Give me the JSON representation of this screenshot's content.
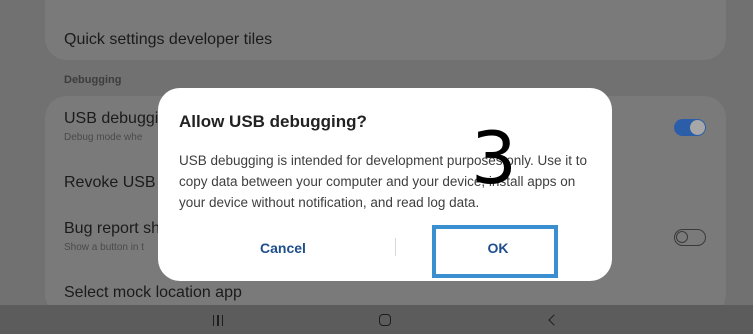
{
  "background": {
    "developer_tiles_label": "Quick settings developer tiles",
    "section_debugging": "Debugging",
    "usb_debugging_label": "USB debuggi",
    "usb_debugging_sub": "Debug mode whe",
    "revoke_label": "Revoke USB d",
    "bug_report_label": "Bug report sh",
    "bug_report_sub": "Show a button in t",
    "mock_location_label": "Select mock location app",
    "usb_debugging_toggle_on": true,
    "bug_report_toggle_on": false
  },
  "dialog": {
    "title": "Allow USB debugging?",
    "body": "USB debugging is intended for development purposes only. Use it to copy data between your computer and your device, install apps on your device without notification, and read log data.",
    "cancel_label": "Cancel",
    "ok_label": "OK"
  },
  "annotation": {
    "step_number": "3",
    "highlight_color": "#3a8fd1"
  },
  "nav": {
    "recents_icon": "recents-icon",
    "home_icon": "home-icon",
    "back_icon": "back-icon"
  },
  "colors": {
    "accent": "#1f4e8c",
    "toggle_on": "#2c5da8",
    "dialog_bg": "#ffffff"
  }
}
